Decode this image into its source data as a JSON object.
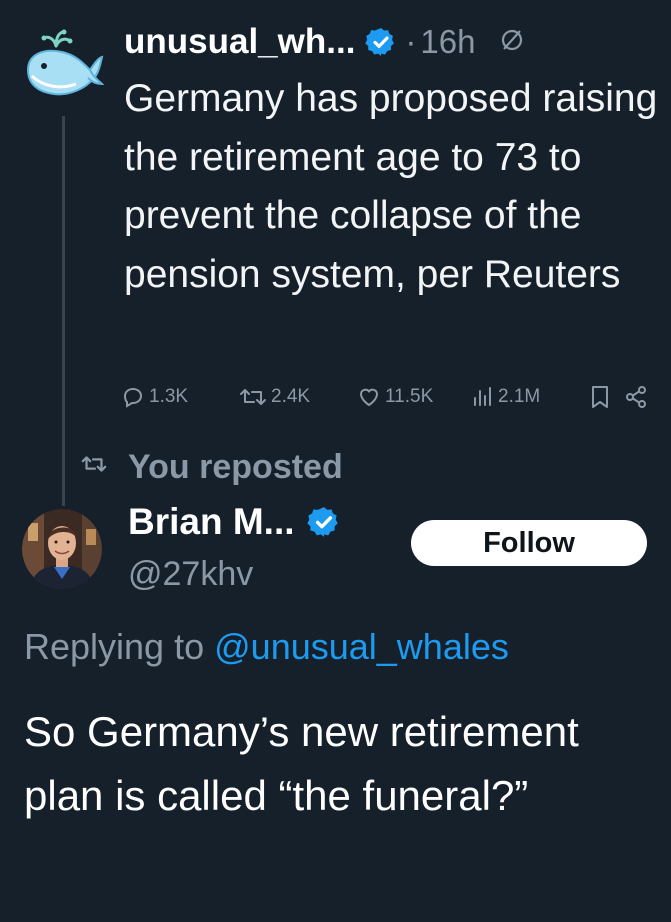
{
  "quoted_post": {
    "display_name": "unusual_wh...",
    "separator": "·",
    "time": "16h",
    "text": "Germany has proposed raising the retirement age to 73 to prevent the collapse of the pension system, per Reuters",
    "actions": {
      "replies": "1.3K",
      "reposts": "2.4K",
      "likes": "11.5K",
      "views": "2.1M"
    },
    "icons": [
      "whale-avatar",
      "verified-badge-icon",
      "grok-null-icon",
      "reply-icon",
      "repost-icon",
      "like-icon",
      "views-icon",
      "bookmark-icon",
      "share-icon"
    ]
  },
  "repost_context": {
    "label": "You reposted"
  },
  "reply_post": {
    "display_name": "Brian M...",
    "handle": "@27khv",
    "follow_label": "Follow",
    "replying_prefix": "Replying to",
    "replying_to": "@unusual_whales",
    "text": "So Germany’s new retirement plan is called “the funeral?”"
  },
  "colors": {
    "background": "#15202b",
    "muted": "#8b98a5",
    "accent": "#1d9bf0",
    "text": "#ffffff"
  }
}
